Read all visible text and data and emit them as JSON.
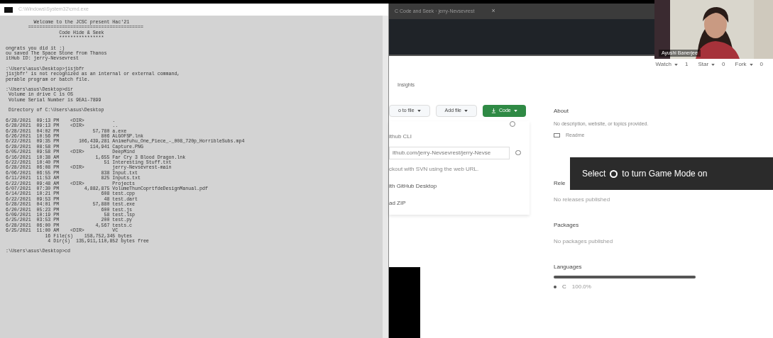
{
  "console": {
    "title": "C:\\Windows\\System32\\cmd.exe",
    "blocks": [
      [
        "          Welcome to the JCSC present Hac'21",
        "        =========================================",
        "                   Code Hide & Seek",
        "                   ****************"
      ],
      [
        "ongrats you did it :)",
        "ou saved The Space Stone from Thanos",
        "itHub ID: jerry-Nevsevrest"
      ],
      [
        ":\\Users\\asus\\Desktop>jisjbfr",
        "jisjbfr' is not recognized as an internal or external command,",
        "perable program or batch file."
      ],
      [
        ":\\Users\\asus\\Desktop>dir",
        " Volume in drive C is OS",
        " Volume Serial Number is 9EA1-7899"
      ],
      [
        " Directory of C:\\Users\\asus\\Desktop"
      ],
      [
        "6/28/2021  09:13 PM    <DIR>          .",
        "6/28/2021  09:13 PM    <DIR>          ..",
        "6/28/2021  04:02 PM            57,780 a.exe",
        "6/26/2021  10:56 PM               806 ALGOFSP.lnk",
        "6/22/2021  09:35 PM       106,439,281 AnimeFuhu_One_Piece_-_008_720p_HorribleSubs.mp4",
        "6/28/2021  08:58 PM           114,941 Capture.PNG",
        "6/05/2021  09:58 PM    <DIR>          DeepMind",
        "6/16/2021  10:38 AM             1,655 Far Cry 3 Blood Dragon.lnk",
        "6/22/2021  10:40 PM                51 Interesting Stuff.txt",
        "6/28/2021  06:08 PM    <DIR>          jerry-Nevsevrest-main",
        "6/06/2021  06:55 PM               838 Input.txt",
        "6/11/2021  11:53 AM               825 Inputs.txt",
        "6/22/2021  09:48 AM    <DIR>          Projects",
        "6/07/2021  07:30 PM         4,882,875 VolumeThunCoprtfdeDesignManual.pdf",
        "6/14/2021  10:21 PM               608 test.cpp",
        "6/22/2021  09:53 PM                48 test.dart",
        "6/28/2021  04:01 PM            57,880 test.exe",
        "6/20/2021  05:23 PM               600 test.js",
        "6/09/2021  10:19 PM                58 test.lsp",
        "6/25/2021  03:53 PM               200 test.py",
        "6/28/2021  06:00 PM             4,567 tests.c",
        "6/25/2021  11:00 AM    <DIR>          VC",
        "              16 File(s)    158,752,345 bytes",
        "               4 Dir(s)  135,911,110,852 bytes free"
      ],
      [
        ":\\Users\\asus\\Desktop>cd"
      ]
    ]
  },
  "browser": {
    "tab_title": "C Code and Seek · jerry-Nevsevrest",
    "tab_close": "×"
  },
  "repo": {
    "actions": [
      {
        "label": "Watch",
        "count": "1"
      },
      {
        "label": "Star",
        "count": "0"
      },
      {
        "label": "Fork",
        "count": "0"
      }
    ],
    "tab": "Insights",
    "buttons": [
      {
        "label": "o to file",
        "kind": "plain"
      },
      {
        "label": "Add file",
        "kind": "plain"
      },
      {
        "label": "Code",
        "kind": "primary"
      }
    ],
    "clone": {
      "label": "ithub CLI",
      "url": "ithub.com/jerry-Nevsevrest/jerry-Nevse",
      "hint": "ckout with SVN using the web URL.",
      "items": [
        "ith GitHub Desktop",
        "ad ZIP"
      ]
    },
    "about": {
      "title": "About",
      "text": "No description, website, or topics provided.",
      "readme": "Readme"
    },
    "sections": [
      {
        "title": "Rele",
        "text": "No releases published"
      },
      {
        "title": "Packages",
        "text": "No packages published"
      }
    ],
    "languages": {
      "title": "Languages",
      "items": [
        {
          "name": "C",
          "percent": "100.0%",
          "color": "#555555",
          "level": 1
        }
      ]
    }
  },
  "toast": {
    "before": "Select",
    "after": "to turn Game Mode on"
  },
  "webcam": {
    "name": "Ayushi Banerjee"
  }
}
